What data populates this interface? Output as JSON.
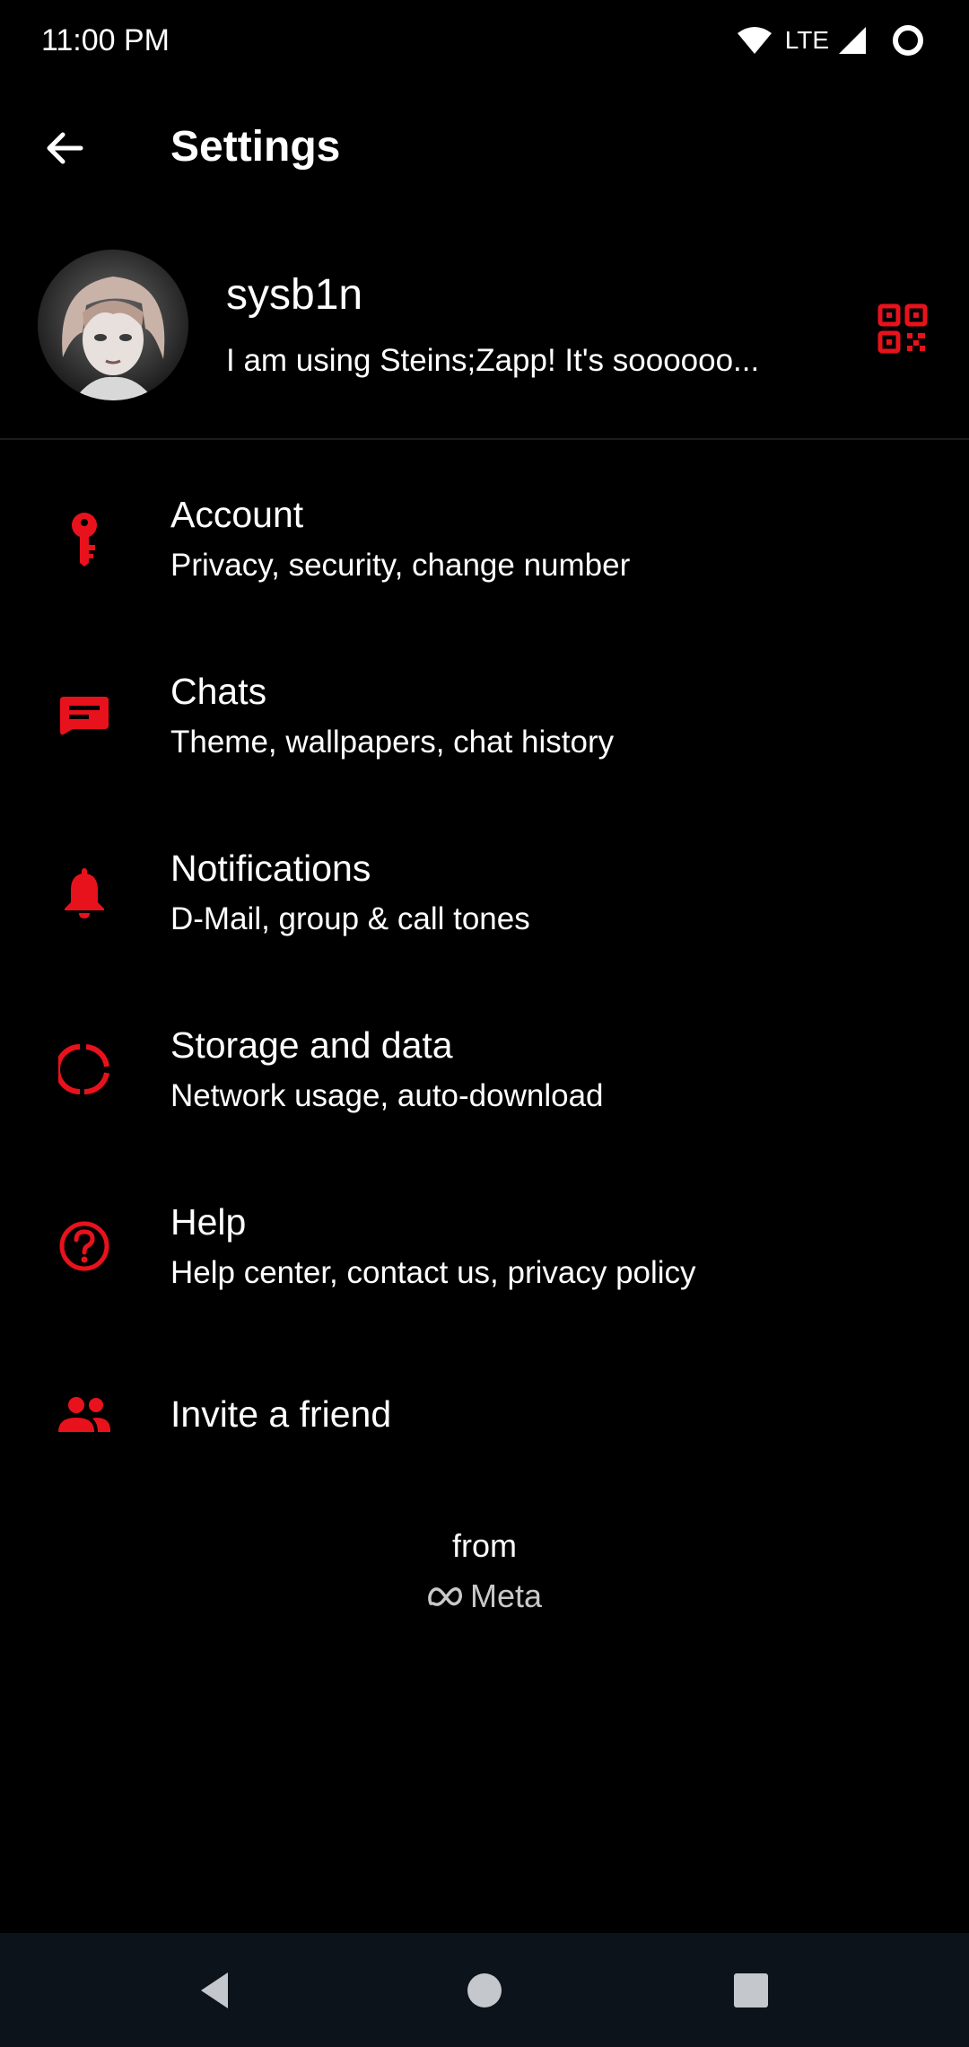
{
  "status_bar": {
    "time": "11:00 PM",
    "network": "LTE",
    "icons": [
      "wifi-icon",
      "lte-signal-icon",
      "battery-ring-icon"
    ]
  },
  "app_bar": {
    "title": "Settings",
    "back_icon": "arrow-left-icon"
  },
  "profile": {
    "name": "sysb1n",
    "status": "I am using Steins;Zapp! It's soooooo...",
    "qr_icon": "qr-code-icon"
  },
  "menu": [
    {
      "title": "Account",
      "subtitle": "Privacy, security, change number",
      "icon": "key-icon"
    },
    {
      "title": "Chats",
      "subtitle": "Theme, wallpapers, chat history",
      "icon": "chat-icon"
    },
    {
      "title": "Notifications",
      "subtitle": "D-Mail, group & call tones",
      "icon": "bell-icon"
    },
    {
      "title": "Storage and data",
      "subtitle": "Network usage, auto-download",
      "icon": "storage-circle-icon"
    },
    {
      "title": "Help",
      "subtitle": "Help center, contact us, privacy policy",
      "icon": "help-circle-icon"
    },
    {
      "title": "Invite a friend",
      "subtitle": "",
      "icon": "people-icon"
    }
  ],
  "footer": {
    "from": "from",
    "brand": "Meta"
  },
  "nav_bar": {
    "buttons": [
      "back-triangle-icon",
      "home-circle-icon",
      "recents-square-icon"
    ]
  },
  "colors": {
    "background": "#000000",
    "accent": "#e8121c",
    "text": "#ffffff",
    "nav_background": "#0d131a"
  }
}
